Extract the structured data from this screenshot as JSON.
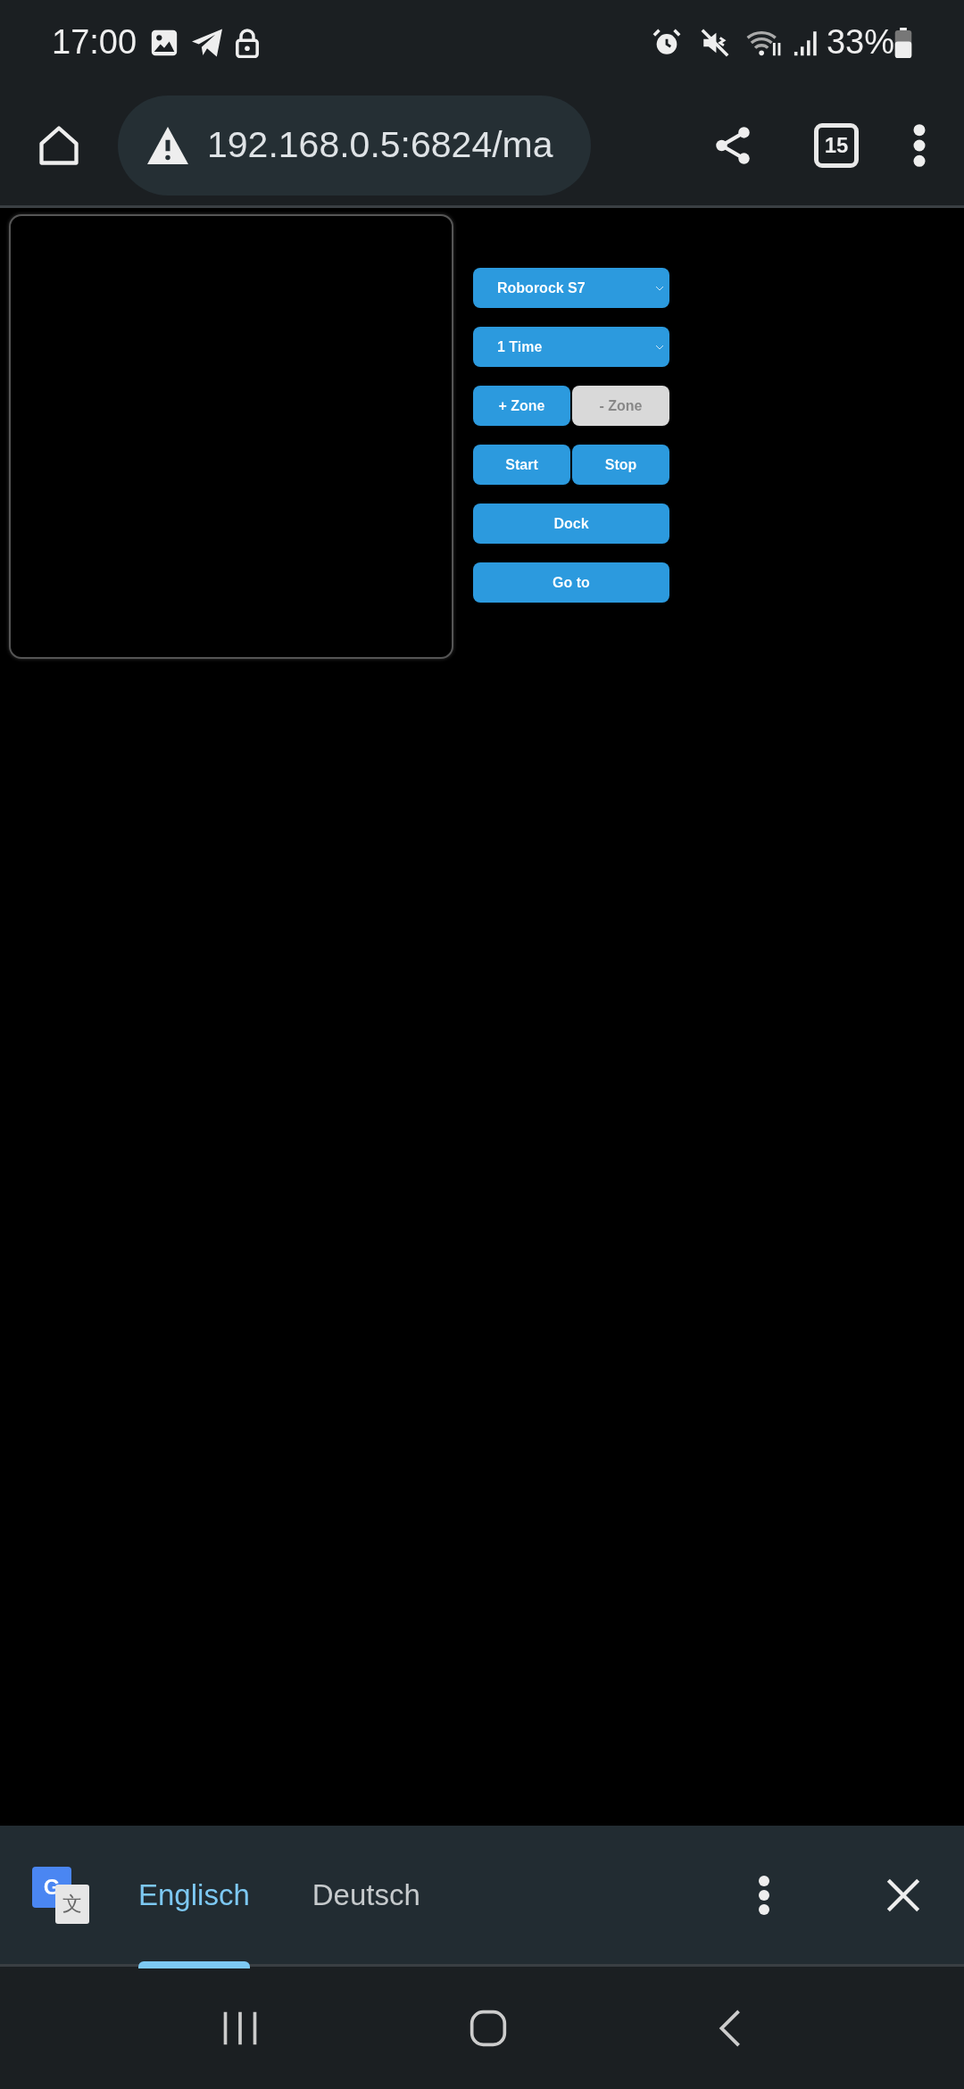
{
  "status_bar": {
    "time": "17:00",
    "battery": "33%"
  },
  "address_bar": {
    "url": "192.168.0.5:6824/ma",
    "tab_count": "15"
  },
  "control_rows": [
    [
      {
        "kind": "select",
        "label": "Roborock S7",
        "disabled": false
      }
    ],
    [
      {
        "kind": "select",
        "label": "1 Time",
        "disabled": false
      }
    ],
    [
      {
        "kind": "button",
        "label": "+ Zone",
        "disabled": false
      },
      {
        "kind": "button",
        "label": "- Zone",
        "disabled": true
      }
    ],
    [
      {
        "kind": "button",
        "label": "Start",
        "disabled": false
      },
      {
        "kind": "button",
        "label": "Stop",
        "disabled": false
      }
    ],
    [
      {
        "kind": "button",
        "label": "Dock",
        "disabled": false
      }
    ],
    [
      {
        "kind": "button",
        "label": "Go to",
        "disabled": false
      }
    ]
  ],
  "translate_bar": {
    "logo_letters": [
      "G",
      "文"
    ],
    "languages": [
      {
        "label": "Englisch",
        "selected": true
      },
      {
        "label": "Deutsch",
        "selected": false
      }
    ]
  }
}
